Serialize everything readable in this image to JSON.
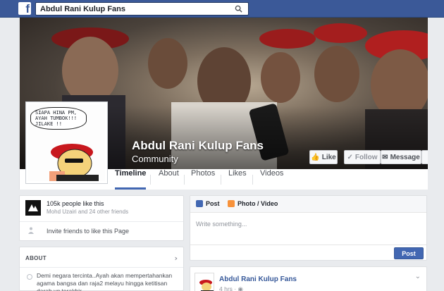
{
  "topbar": {
    "logo": "f",
    "search_value": "Abdul Rani Kulup Fans",
    "search_icon": "search-icon"
  },
  "page": {
    "name": "Abdul Rani Kulup Fans",
    "category": "Community"
  },
  "cover_buttons": {
    "like": "Like",
    "follow": "Follow",
    "message": "Message",
    "more": "•••"
  },
  "profile_picture": {
    "bubble_text": "SIAPA HINA PM, AYAH TUMBOK!!! JILAKE !!"
  },
  "tabs": [
    "Timeline",
    "About",
    "Photos",
    "Likes",
    "Videos"
  ],
  "likes_card": {
    "count": "105k people like this",
    "friends": "Mohd Uzairi and 24 other friends",
    "invite": "Invite friends to like this Page"
  },
  "about_card": {
    "title": "ABOUT",
    "description": "Demi negara tercinta..Ayah akan mempertahankan agama bangsa dan raja2 melayu hingga ketitisan darah yg terakhir"
  },
  "composer": {
    "tab_post": "Post",
    "tab_photo": "Photo / Video",
    "placeholder": "Write something...",
    "post_button": "Post"
  },
  "feed": {
    "author": "Abdul Rani Kulup Fans",
    "time": "4 hrs · ",
    "globe_icon": "globe-icon"
  },
  "colors": {
    "brand": "#3b5998",
    "button_blue": "#4267b2",
    "link": "#365899",
    "background": "#e9ebee"
  }
}
